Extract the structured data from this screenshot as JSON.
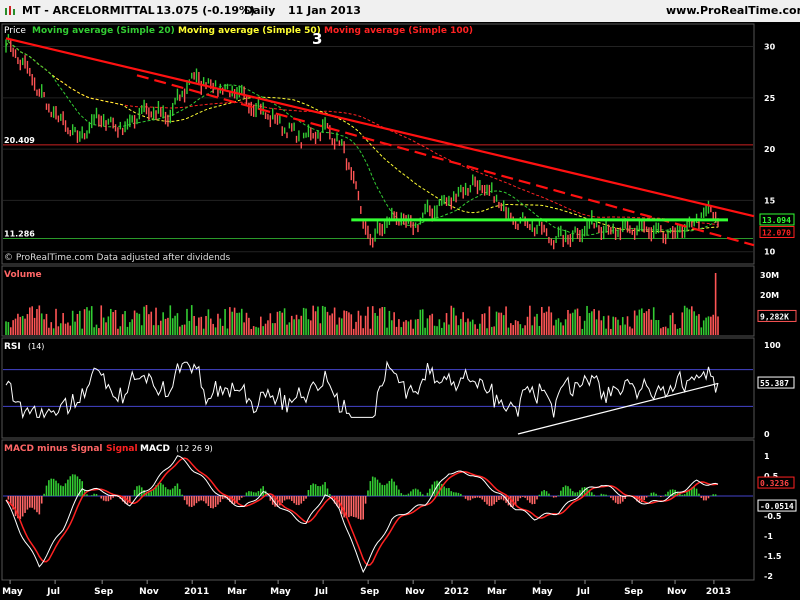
{
  "header": {
    "symbol": "MT - ARCELORMITTAL",
    "last": "13.075 (-0.19%)",
    "period": "Daily",
    "date": "11 Jan 2013",
    "site": "www.ProRealTime.com"
  },
  "colors": {
    "ma20": "#33cc33",
    "ma50": "#ffff33",
    "ma100": "#ff2222",
    "trend_support": "#33ff33",
    "trend_resistance": "#ff1111",
    "rsi": "#ffffff",
    "macd": "#ffffff",
    "signal": "#ff2222",
    "hist_pos": "#33cc33",
    "hist_neg": "#ff6666",
    "up_volume": "#33cc33",
    "down_volume": "#ff5555"
  },
  "chart_data": [
    {
      "type": "line",
      "name": "price",
      "legend": {
        "prefix": "Price",
        "ma20": "Moving average (Simple 20)",
        "ma50": "Moving average (Simple 50)",
        "ma100": "Moving average (Simple 100)"
      },
      "annotation_number": "3",
      "footer_note": "© ProRealTime.com  Data adjusted after dividends",
      "ylim": [
        9,
        32
      ],
      "yticks": [
        10,
        15,
        20,
        25,
        30
      ],
      "levels": [
        {
          "label": "20.409",
          "value": 20.409
        },
        {
          "label": "11.286",
          "value": 11.286
        }
      ],
      "badges": [
        {
          "label": "13.094",
          "value": 13.094,
          "color": "#33ff33"
        },
        {
          "label": "12.070",
          "value": 12.07,
          "color": "#ff2222"
        }
      ],
      "anchors": [
        {
          "i": 0,
          "v": 30.5
        },
        {
          "i": 8,
          "v": 28
        },
        {
          "i": 18,
          "v": 24
        },
        {
          "i": 30,
          "v": 21
        },
        {
          "i": 38,
          "v": 23
        },
        {
          "i": 50,
          "v": 22
        },
        {
          "i": 58,
          "v": 24
        },
        {
          "i": 68,
          "v": 23
        },
        {
          "i": 78,
          "v": 27
        },
        {
          "i": 90,
          "v": 26
        },
        {
          "i": 100,
          "v": 25
        },
        {
          "i": 112,
          "v": 23
        },
        {
          "i": 124,
          "v": 21
        },
        {
          "i": 134,
          "v": 22
        },
        {
          "i": 140,
          "v": 20.8
        },
        {
          "i": 146,
          "v": 17
        },
        {
          "i": 150,
          "v": 12.8
        },
        {
          "i": 154,
          "v": 11
        },
        {
          "i": 158,
          "v": 12.5
        },
        {
          "i": 164,
          "v": 13.5
        },
        {
          "i": 170,
          "v": 12.3
        },
        {
          "i": 178,
          "v": 14
        },
        {
          "i": 186,
          "v": 15
        },
        {
          "i": 196,
          "v": 16.7
        },
        {
          "i": 204,
          "v": 15.5
        },
        {
          "i": 212,
          "v": 13.5
        },
        {
          "i": 222,
          "v": 12.5
        },
        {
          "i": 230,
          "v": 11.2
        },
        {
          "i": 238,
          "v": 11.6
        },
        {
          "i": 248,
          "v": 12.8
        },
        {
          "i": 256,
          "v": 11.8
        },
        {
          "i": 266,
          "v": 12.3
        },
        {
          "i": 276,
          "v": 11.5
        },
        {
          "i": 286,
          "v": 12.2
        },
        {
          "i": 292,
          "v": 13.5
        },
        {
          "i": 296,
          "v": 13.9
        },
        {
          "i": 299,
          "v": 13.075
        }
      ],
      "trendlines": [
        {
          "kind": "solid-red",
          "x": [
            0,
            299
          ],
          "y": [
            30.8,
            14.3
          ]
        },
        {
          "kind": "dashed-red",
          "x": [
            55,
            299
          ],
          "y": [
            27.2,
            11.6
          ]
        },
        {
          "kind": "green",
          "x": [
            145,
            299
          ],
          "y": [
            13.1,
            13.1
          ]
        }
      ]
    },
    {
      "type": "bar",
      "name": "volume",
      "title": "Volume",
      "yticks": [
        {
          "label": "30M",
          "value": 30
        },
        {
          "label": "20M",
          "value": 20
        }
      ],
      "ylim": [
        0,
        33
      ],
      "last_label": "9,282K",
      "last_value": 9.282,
      "spike_value": 31,
      "typical_range": [
        3,
        15
      ]
    },
    {
      "type": "line",
      "name": "rsi",
      "title": "RSI",
      "params": "(14)",
      "ylim": [
        0,
        100
      ],
      "yticks": [
        0,
        100
      ],
      "bands": [
        30,
        70
      ],
      "last_label": "55.387",
      "last_value": 55.387,
      "trendline": {
        "x": [
          215,
          299
        ],
        "y": [
          0,
          55
        ]
      }
    },
    {
      "type": "area",
      "name": "macd",
      "legend": {
        "hist": "MACD minus Signal",
        "signal": "Signal",
        "macd": "MACD"
      },
      "params": "(12 26 9)",
      "ylim": [
        -2.05,
        1.25
      ],
      "yticks": [
        {
          "label": "1",
          "value": 1
        },
        {
          "label": "0.5",
          "value": 0.5
        },
        {
          "label": "-0.5",
          "value": -0.5
        },
        {
          "label": "-1",
          "value": -1
        },
        {
          "label": "-1.5",
          "value": -1.5
        },
        {
          "label": "-2",
          "value": -2
        }
      ],
      "badges": [
        {
          "label": "0.3236",
          "value": 0.3236,
          "color": "#ff2222"
        },
        {
          "label": "-0.0514",
          "value": -0.0514,
          "color": "#ffffff"
        }
      ],
      "anchors": [
        {
          "i": 0,
          "v": -0.1
        },
        {
          "i": 6,
          "v": -0.9
        },
        {
          "i": 14,
          "v": -1.75
        },
        {
          "i": 24,
          "v": -0.8
        },
        {
          "i": 32,
          "v": 0.2
        },
        {
          "i": 42,
          "v": 0.1
        },
        {
          "i": 52,
          "v": -0.2
        },
        {
          "i": 62,
          "v": 0.3
        },
        {
          "i": 72,
          "v": 1.0
        },
        {
          "i": 80,
          "v": 0.6
        },
        {
          "i": 90,
          "v": 0.0
        },
        {
          "i": 100,
          "v": -0.3
        },
        {
          "i": 108,
          "v": 0.1
        },
        {
          "i": 118,
          "v": -0.4
        },
        {
          "i": 126,
          "v": -0.7
        },
        {
          "i": 134,
          "v": 0.05
        },
        {
          "i": 140,
          "v": -0.3
        },
        {
          "i": 146,
          "v": -1.3
        },
        {
          "i": 150,
          "v": -1.85
        },
        {
          "i": 156,
          "v": -1.2
        },
        {
          "i": 162,
          "v": -0.6
        },
        {
          "i": 168,
          "v": -0.4
        },
        {
          "i": 176,
          "v": -0.2
        },
        {
          "i": 186,
          "v": 0.6
        },
        {
          "i": 196,
          "v": 0.55
        },
        {
          "i": 204,
          "v": 0.2
        },
        {
          "i": 214,
          "v": -0.3
        },
        {
          "i": 222,
          "v": -0.55
        },
        {
          "i": 232,
          "v": -0.4
        },
        {
          "i": 242,
          "v": 0.1
        },
        {
          "i": 250,
          "v": 0.3
        },
        {
          "i": 260,
          "v": 0.0
        },
        {
          "i": 270,
          "v": -0.2
        },
        {
          "i": 280,
          "v": 0.0
        },
        {
          "i": 290,
          "v": 0.35
        },
        {
          "i": 296,
          "v": 0.3
        },
        {
          "i": 299,
          "v": 0.25
        }
      ]
    }
  ],
  "xaxis": {
    "ticks": [
      {
        "label": "May",
        "i": 2
      },
      {
        "label": "Jul",
        "i": 24
      },
      {
        "label": "Sep",
        "i": 47
      },
      {
        "label": "Nov",
        "i": 69
      },
      {
        "label": "2011",
        "i": 91
      },
      {
        "label": "Mar",
        "i": 112
      },
      {
        "label": "May",
        "i": 133
      },
      {
        "label": "Jul",
        "i": 155
      },
      {
        "label": "Sep",
        "i": 177
      },
      {
        "label": "Nov",
        "i": 199
      },
      {
        "label": "2012",
        "i": 218
      },
      {
        "label": "Mar",
        "i": 239
      },
      {
        "label": "May",
        "i": 261
      },
      {
        "label": "Jul",
        "i": 283
      },
      {
        "label": "Sep",
        "i": 306
      },
      {
        "label": "Nov",
        "i": 327
      },
      {
        "label": "2013",
        "i": 346
      }
    ],
    "points": 300
  }
}
